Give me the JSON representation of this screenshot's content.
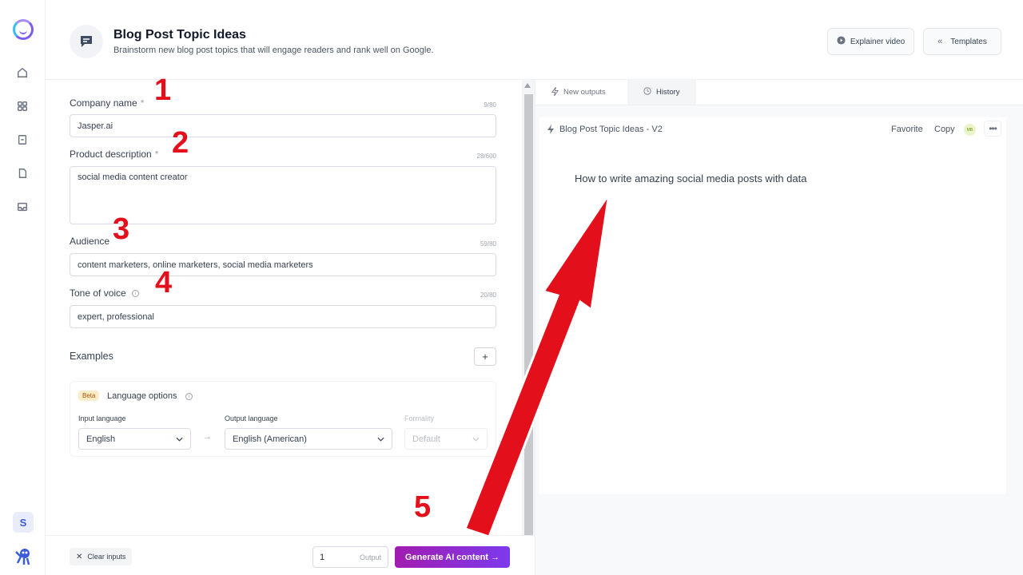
{
  "header": {
    "title": "Blog Post Topic Ideas",
    "subtitle": "Brainstorm new blog post topics that will engage readers and rank well on Google.",
    "explainer_label": "Explainer video",
    "templates_label": "Templates"
  },
  "sidebar": {
    "avatar_letter": "S",
    "icons": [
      "home-icon",
      "apps-icon",
      "document-icon",
      "file-icon",
      "inbox-icon"
    ]
  },
  "form": {
    "company": {
      "label": "Company name",
      "required": "*",
      "count": "9/80",
      "value": "Jasper.ai"
    },
    "product": {
      "label": "Product description",
      "required": "*",
      "count": "28/600",
      "value": "social media content creator"
    },
    "audience": {
      "label": "Audience",
      "count": "59/80",
      "value": "content marketers, online marketers, social media marketers"
    },
    "tone": {
      "label": "Tone of voice",
      "count": "20/80",
      "value": "expert, professional"
    },
    "examples_label": "Examples",
    "examples_add": "+",
    "language": {
      "beta": "Beta",
      "title": "Language options",
      "input_label": "Input language",
      "input_value": "English",
      "arrow": "→",
      "output_label": "Output language",
      "output_value": "English (American)",
      "formality_label": "Formality",
      "formality_value": "Default"
    }
  },
  "footer": {
    "clear_label": "Clear inputs",
    "output_count": "1",
    "output_label": "Output",
    "generate_label": "Generate AI content →"
  },
  "output": {
    "tab_new": "New outputs",
    "tab_history": "History",
    "card_title": "Blog Post Topic Ideas - V2",
    "favorite": "Favorite",
    "copy": "Copy",
    "avatar_initials": "MB",
    "more": "•••",
    "result": "How to write amazing social media posts with data"
  },
  "annotations": [
    "1",
    "2",
    "3",
    "4",
    "5"
  ],
  "colors": {
    "accent": "#7c3aed",
    "annotation": "#e3101c"
  }
}
